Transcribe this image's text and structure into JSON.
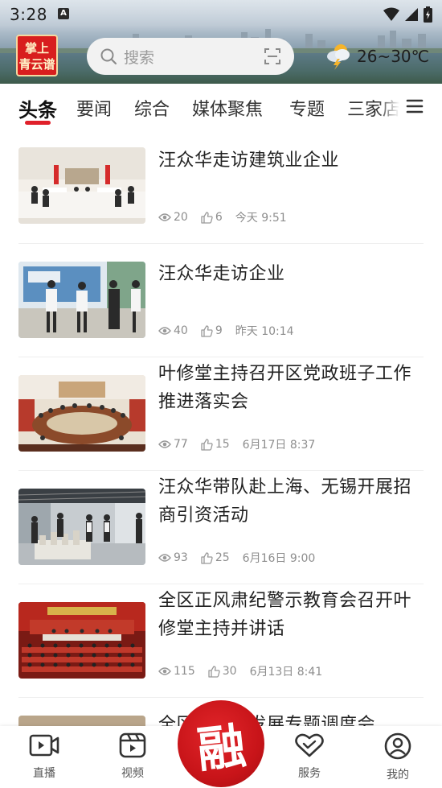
{
  "status_bar": {
    "time": "3:28",
    "notification_letter": "A"
  },
  "header": {
    "logo_line1": "掌上",
    "logo_line2": "青云谱",
    "search_placeholder": "搜索",
    "weather_temp": "26~30℃"
  },
  "tabs": [
    {
      "label": "头条",
      "active": true
    },
    {
      "label": "要闻",
      "active": false
    },
    {
      "label": "综合",
      "active": false
    },
    {
      "label": "媒体聚焦",
      "active": false
    },
    {
      "label": "专题",
      "active": false
    },
    {
      "label": "三家店",
      "active": false
    }
  ],
  "news": [
    {
      "title": "汪众华走访建筑业企业",
      "views": "20",
      "likes": "6",
      "time": "今天 9:51"
    },
    {
      "title": "汪众华走访企业",
      "views": "40",
      "likes": "9",
      "time": "昨天 10:14"
    },
    {
      "title": "叶修堂主持召开区党政班子工作推进落实会",
      "views": "77",
      "likes": "15",
      "time": "6月17日 8:37"
    },
    {
      "title": "汪众华带队赴上海、无锡开展招商引资活动",
      "views": "93",
      "likes": "25",
      "time": "6月16日 9:00"
    },
    {
      "title": "全区正风肃纪警示教育会召开叶修堂主持并讲话",
      "views": "115",
      "likes": "30",
      "time": "6月13日 8:41"
    },
    {
      "title": "全区…经济发展专题调度会",
      "views": "",
      "likes": "",
      "time": ""
    }
  ],
  "bottom_nav": {
    "live": "直播",
    "video": "视频",
    "fusion": "融",
    "service": "服务",
    "mine": "我的"
  },
  "colors": {
    "accent": "#e0202a",
    "fusion_button": "#c81419"
  }
}
